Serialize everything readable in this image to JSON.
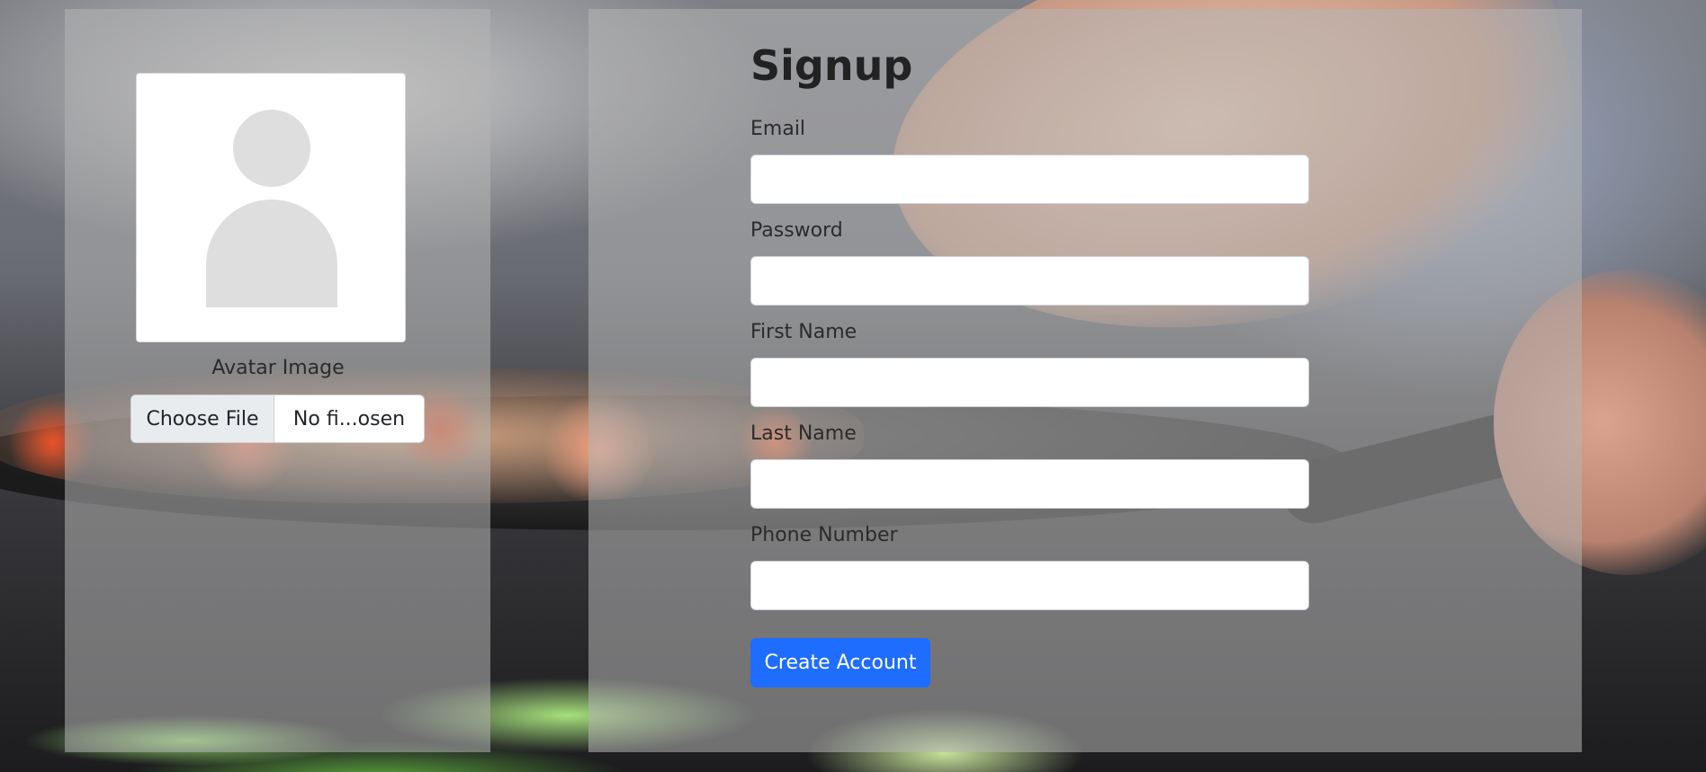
{
  "avatar": {
    "label": "Avatar Image",
    "file_button": "Choose File",
    "file_status": "No fi...osen"
  },
  "form": {
    "title": "Signup",
    "fields": [
      {
        "label": "Email",
        "value": "",
        "placeholder": ""
      },
      {
        "label": "Password",
        "value": "",
        "placeholder": ""
      },
      {
        "label": "First Name",
        "value": "",
        "placeholder": ""
      },
      {
        "label": "Last Name",
        "value": "",
        "placeholder": ""
      },
      {
        "label": "Phone Number",
        "value": "",
        "placeholder": ""
      }
    ],
    "submit_label": "Create Account"
  },
  "colors": {
    "primary_button": "#1f6dff",
    "panel_overlay": "rgba(180,180,180,0.55)"
  }
}
